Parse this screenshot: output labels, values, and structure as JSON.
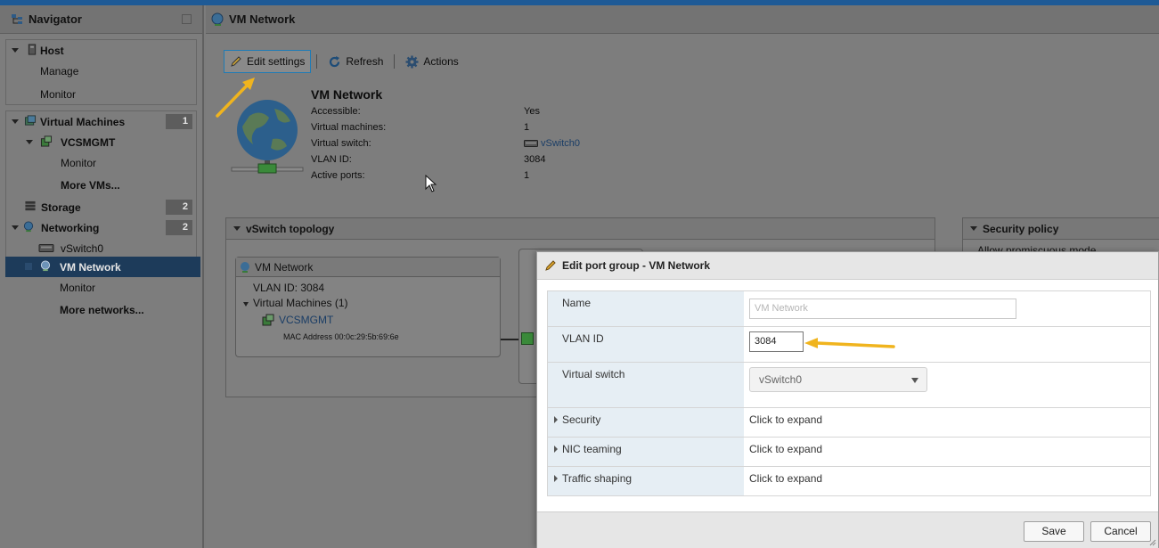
{
  "navigator": {
    "title": "Navigator",
    "host": {
      "label": "Host",
      "children": [
        "Manage",
        "Monitor"
      ]
    },
    "virtual_machines": {
      "label": "Virtual Machines",
      "count": "1",
      "vm": "VCSMGMT",
      "children": [
        "Monitor",
        "More VMs..."
      ]
    },
    "storage": {
      "label": "Storage",
      "count": "2"
    },
    "networking": {
      "label": "Networking",
      "count": "2",
      "children": [
        "vSwitch0",
        "VM Network"
      ],
      "sub": [
        "Monitor",
        "More networks..."
      ]
    }
  },
  "main": {
    "title": "VM Network",
    "toolbar": {
      "edit": "Edit settings",
      "refresh": "Refresh",
      "actions": "Actions"
    },
    "summary": {
      "title": "VM Network",
      "rows": [
        {
          "key": "Accessible:",
          "value": "Yes"
        },
        {
          "key": "Virtual machines:",
          "value": "1"
        },
        {
          "key": "Virtual switch:",
          "value": "vSwitch0"
        },
        {
          "key": "VLAN ID:",
          "value": "3084"
        },
        {
          "key": "Active ports:",
          "value": "1"
        }
      ]
    },
    "topology": {
      "title": "vSwitch topology",
      "portgroup": "VM Network",
      "vlan": "VLAN ID: 3084",
      "vms": "Virtual Machines (1)",
      "vm": "VCSMGMT",
      "mac": "MAC Address 00:0c:29:5b:69:6e"
    },
    "security": {
      "title": "Security policy",
      "first": "Allow promiscuous mode"
    }
  },
  "dialog": {
    "title": "Edit port group - VM Network",
    "name_label": "Name",
    "name_placeholder": "VM Network",
    "vlan_label": "VLAN ID",
    "vlan_value": "3084",
    "vswitch_label": "Virtual switch",
    "vswitch_value": "vSwitch0",
    "sections": [
      {
        "label": "Security",
        "value": "Click to expand"
      },
      {
        "label": "NIC teaming",
        "value": "Click to expand"
      },
      {
        "label": "Traffic shaping",
        "value": "Click to expand"
      }
    ],
    "save": "Save",
    "cancel": "Cancel"
  },
  "colors": {
    "accent": "#1f7bb5",
    "annotation_arrow": "#f0b41e",
    "selected_nav": "#1d3b5a"
  }
}
